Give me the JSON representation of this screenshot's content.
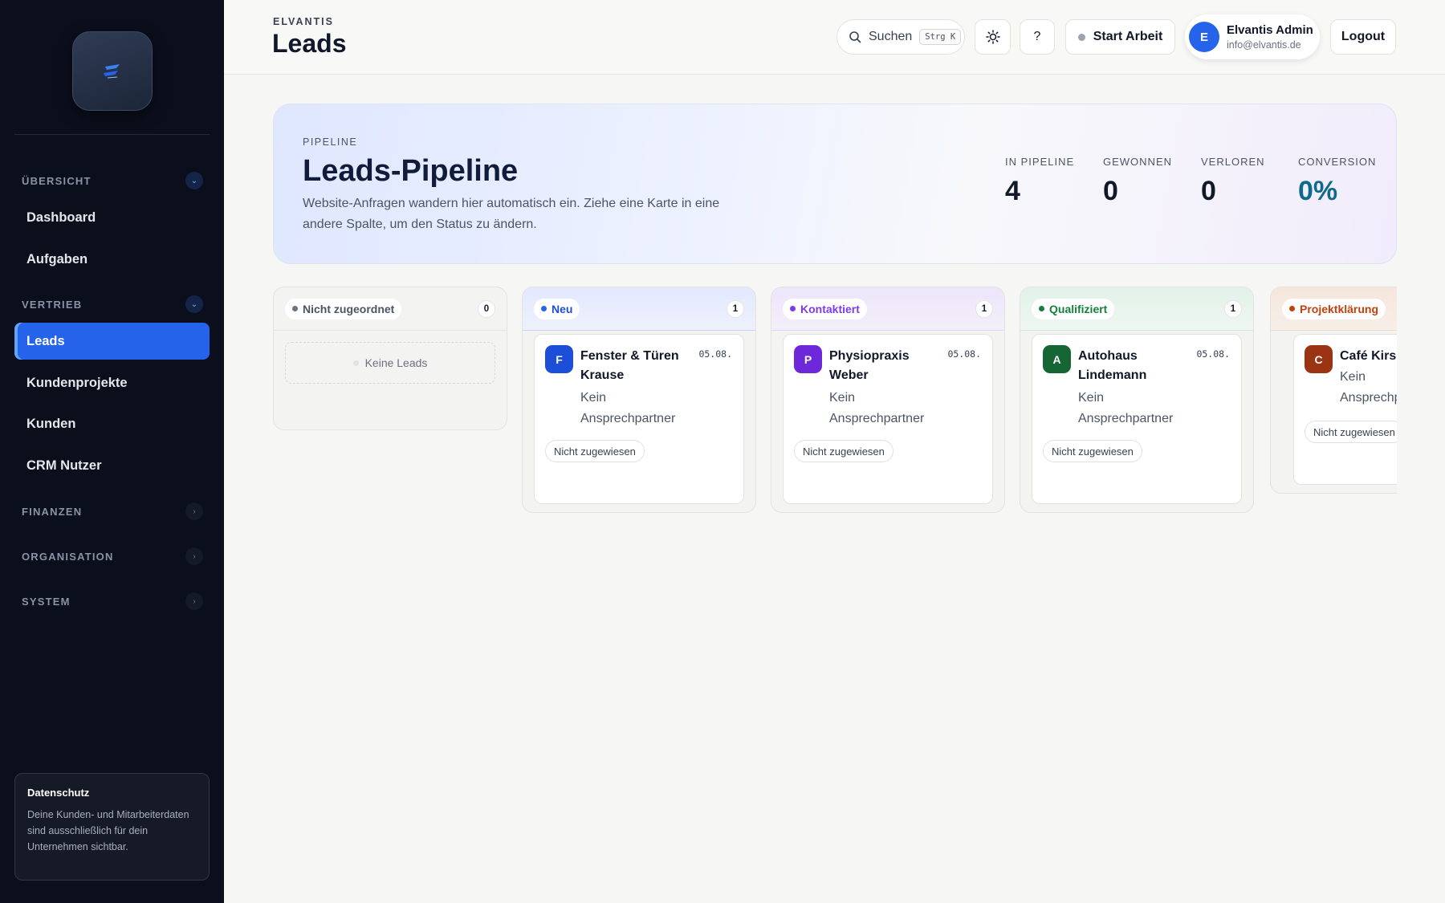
{
  "sidebar": {
    "sections": [
      {
        "title": "ÜBERSICHT",
        "state": "open"
      },
      {
        "title": "VERTRIEB",
        "state": "open"
      },
      {
        "title": "FINANZEN",
        "state": "closed"
      },
      {
        "title": "ORGANISATION",
        "state": "closed"
      },
      {
        "title": "SYSTEM",
        "state": "closed"
      }
    ],
    "items": [
      {
        "label": "Dashboard"
      },
      {
        "label": "Aufgaben"
      },
      {
        "label": "Leads",
        "active": true
      },
      {
        "label": "Kundenprojekte"
      },
      {
        "label": "Kunden"
      },
      {
        "label": "CRM Nutzer"
      }
    ],
    "privacy": {
      "title": "Datenschutz",
      "text": "Deine Kunden- und Mitarbeiterdaten sind ausschließlich für dein Unternehmen sichtbar."
    }
  },
  "header": {
    "brand": "ELVANTIS",
    "title": "Leads",
    "search_label": "Suchen",
    "search_shortcut": "Strg K",
    "help_label": "?",
    "start_work_label": "Start Arbeit",
    "user": {
      "initial": "E",
      "name": "Elvantis Admin",
      "email": "info@elvantis.de"
    },
    "logout_label": "Logout"
  },
  "hero": {
    "kicker": "PIPELINE",
    "title": "Leads-Pipeline",
    "description": "Website-Anfragen wandern hier automatisch ein. Ziehe eine Karte in eine andere Spalte, um den Status zu ändern.",
    "stats": [
      {
        "label": "IN PIPELINE",
        "value": "4"
      },
      {
        "label": "GEWONNEN",
        "value": "0"
      },
      {
        "label": "VERLOREN",
        "value": "0"
      },
      {
        "label": "CONVERSION",
        "value": "0%"
      }
    ]
  },
  "board": {
    "columns": [
      {
        "name": "Nicht zugeordnet",
        "count": "0",
        "empty_label": "Keine Leads",
        "color": "#6b7280"
      },
      {
        "name": "Neu",
        "count": "1",
        "color": "#2563eb"
      },
      {
        "name": "Kontaktiert",
        "count": "1",
        "color": "#7c3aed"
      },
      {
        "name": "Qualifiziert",
        "count": "1",
        "color": "#15803d"
      },
      {
        "name": "Projektklärung",
        "color": "#c2410c"
      }
    ],
    "cards": [
      {
        "initial": "F",
        "title": "Fenster & Türen Krause",
        "date": "05.08.",
        "contact": "Kein Ansprechpartner",
        "assignee": "Nicht zugewiesen",
        "color": "#1d4ed8"
      },
      {
        "initial": "P",
        "title": "Physiopraxis Weber",
        "date": "05.08.",
        "contact": "Kein Ansprechpartner",
        "assignee": "Nicht zugewiesen",
        "color": "#6d28d9"
      },
      {
        "initial": "A",
        "title": "Autohaus Lindemann",
        "date": "05.08.",
        "contact": "Kein Ansprechpartner",
        "assignee": "Nicht zugewiesen",
        "color": "#166534"
      },
      {
        "initial": "C",
        "title": "Café Kirsch",
        "contact": "Kein Ansprechpartner",
        "assignee": "Nicht zugewiesen",
        "color": "#9a3412"
      }
    ]
  }
}
